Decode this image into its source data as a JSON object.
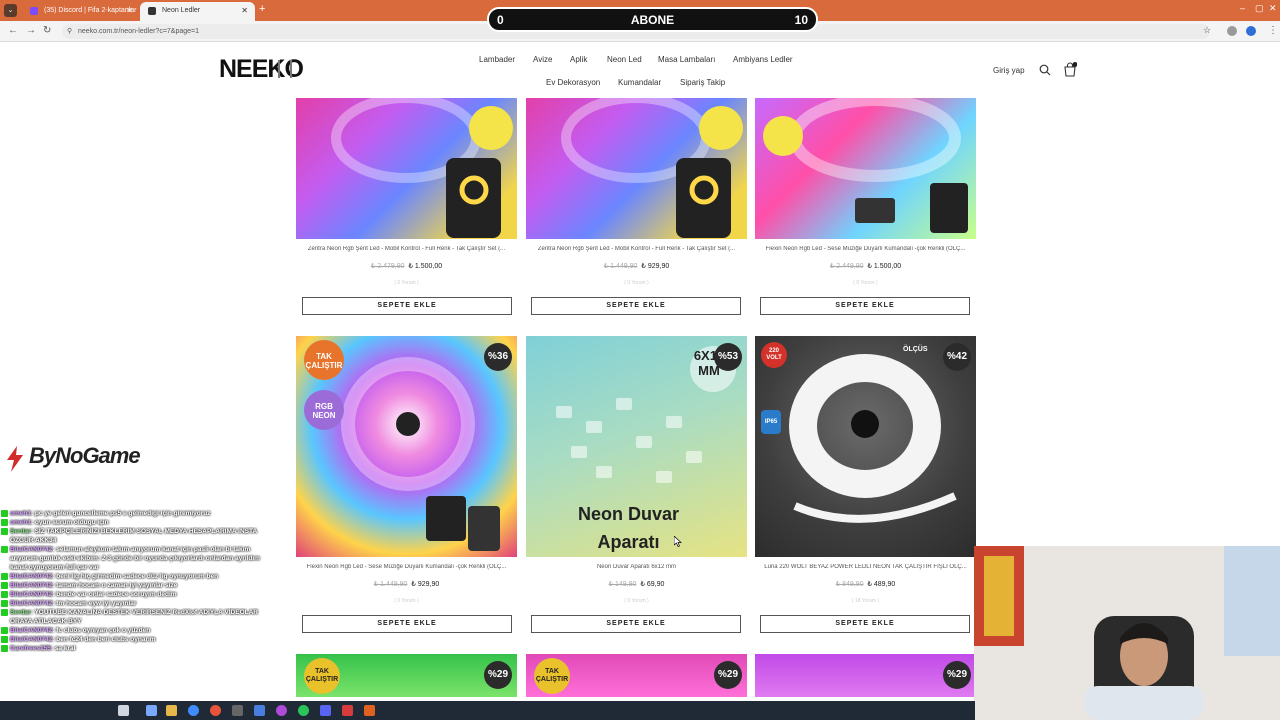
{
  "browser": {
    "tabs": [
      {
        "label": "(35) Discord | Fifa 2-kaptanlar",
        "fav_color": "#7c4dff"
      },
      {
        "label": "Neon Ledler",
        "fav_color": "#333333"
      }
    ],
    "url": "neeko.com.tr/neon-ledler?c=7&page=1"
  },
  "overlay_abone": {
    "left": "0",
    "label": "ABONE",
    "right": "10"
  },
  "site": {
    "logo": "NEEKO",
    "menu_row1": [
      "Lambader",
      "Avize",
      "Aplik",
      "Neon Led",
      "Masa Lambaları",
      "Ambiyans Ledler"
    ],
    "menu_row2": [
      "Ev Dekorasyon",
      "Kumandalar",
      "Sipariş Takip"
    ],
    "login": "Giriş yap",
    "cart_count": "0"
  },
  "products_row1": [
    {
      "title": "Zentra Neon Rgb Şerit Led - Mobil Kontrol - Full Renk - Tak Çalıştır Set (...",
      "old_price": "₺ 2.479,90",
      "price": "₺ 1.500,00",
      "reviews": "( 0 Yorum )",
      "button": "SEPETE EKLE"
    },
    {
      "title": "Zentra Neon Rgb Şerit Led - Mobil Kontrol - Full Renk - Tak Çalıştır Set (...",
      "old_price": "₺ 1.449,90",
      "price": "₺ 929,90",
      "reviews": "( 0 Yorum )",
      "button": "SEPETE EKLE"
    },
    {
      "title": "Flexin Neon Rgb Led - Sese Müziğe Duyarlı Kumandalı -çok Renkli (ÖLÇ...",
      "old_price": "₺ 2.449,90",
      "price": "₺ 1.500,00",
      "reviews": "( 0 Yorum )",
      "button": "SEPETE EKLE"
    }
  ],
  "products_row2": [
    {
      "title": "Flexin Neon Rgb Led - Sese Müziğe Duyarlı Kumandalı -çok Renkli (ÖLÇ...",
      "old_price": "₺ 1.449,90",
      "price": "₺ 929,90",
      "reviews": "( 0 Yorum )",
      "button": "SEPETE EKLE",
      "discount": "%36",
      "badge1": "TAK ÇALIŞTIR",
      "badge2": "RGB NEON"
    },
    {
      "title": "Neon Duvar Aparatı 6x12 mm",
      "old_price": "₺ 149,90",
      "price": "₺ 69,90",
      "reviews": "( 0 Yorum )",
      "button": "SEPETE EKLE",
      "discount": "%53",
      "size_tag": "6X12 MM",
      "image_text": "Neon Duvar Aparatı"
    },
    {
      "title": "Luna 220 WOLT BEYAZ POWER LEDLİ NEON TAK ÇALIŞTIR FİŞLİ ÖLÇ...",
      "old_price": "₺ 849,90",
      "price": "₺ 489,90",
      "reviews": "( 18 Yorum )",
      "button": "SEPETE EKLE",
      "discount": "%42",
      "badge1": "220 VOLT",
      "badge2": "ÖLÇÜS",
      "badge3": "IP65"
    }
  ],
  "products_row3": [
    {
      "discount": "%29",
      "badge1": "TAK ÇALIŞTIR"
    },
    {
      "discount": "%29",
      "badge1": "TAK ÇALIŞTIR"
    },
    {
      "discount": "%29",
      "badge1": ""
    }
  ],
  "stream": {
    "brand": "ByNoGame",
    "chat": [
      {
        "user": "omeh1",
        "text": ": pc ye geleri guncelleme ps5 e gelmedigi için giremiyoruz"
      },
      {
        "user": "omeh1",
        "text": ": oyun surum oldugu için"
      },
      {
        "user": "Serdar",
        "text": ": SİZ TAKİPÇİLERİNİZİ BEKLERİM SOSYAL MEDYA HESAPLARIMA INSTA ÖZGÜR AKK34"
      },
      {
        "user": "BilalCAN0742",
        "text": ": selamun aleykum takım anıyorum kanat için pasli olan bi takım arıyorum gunluk eski ekibim: 2-3 günde bir oyunda çıkıyorlardı onlardan ayrıldım kanat oynuyorum full çar var"
      },
      {
        "user": "BilalCAN0742",
        "text": ": beni lig hiç girmedim sadece düz lig oynuyorum ben"
      },
      {
        "user": "BilalCAN0742",
        "text": ": tamam hocam o zaman iyi yayınlar size"
      },
      {
        "user": "BilalCAN0742",
        "text": ": bende var onlar sadece soruyım dedim"
      },
      {
        "user": "BilalCAN0742",
        "text": ": tm hocam eyw iyi yayınlar"
      },
      {
        "user": "Serdar",
        "text": ": YOUTUBE KANALINA DESTEK VERİRSENİZ RedXlof ADIYLA VİDEOLAR ORAYA ATILACAK BYY"
      },
      {
        "user": "BilalCAN0742",
        "text": ": fc clubs oynıyan çok o yüzden"
      },
      {
        "user": "BilalCAN0742",
        "text": ": ben fc24 den beri clubs oynarım"
      },
      {
        "user": "Carefrees155",
        "text": ": sa kral"
      }
    ]
  },
  "colors": {
    "accent": "#d86a3c",
    "chrome": "#f4f4f4"
  }
}
